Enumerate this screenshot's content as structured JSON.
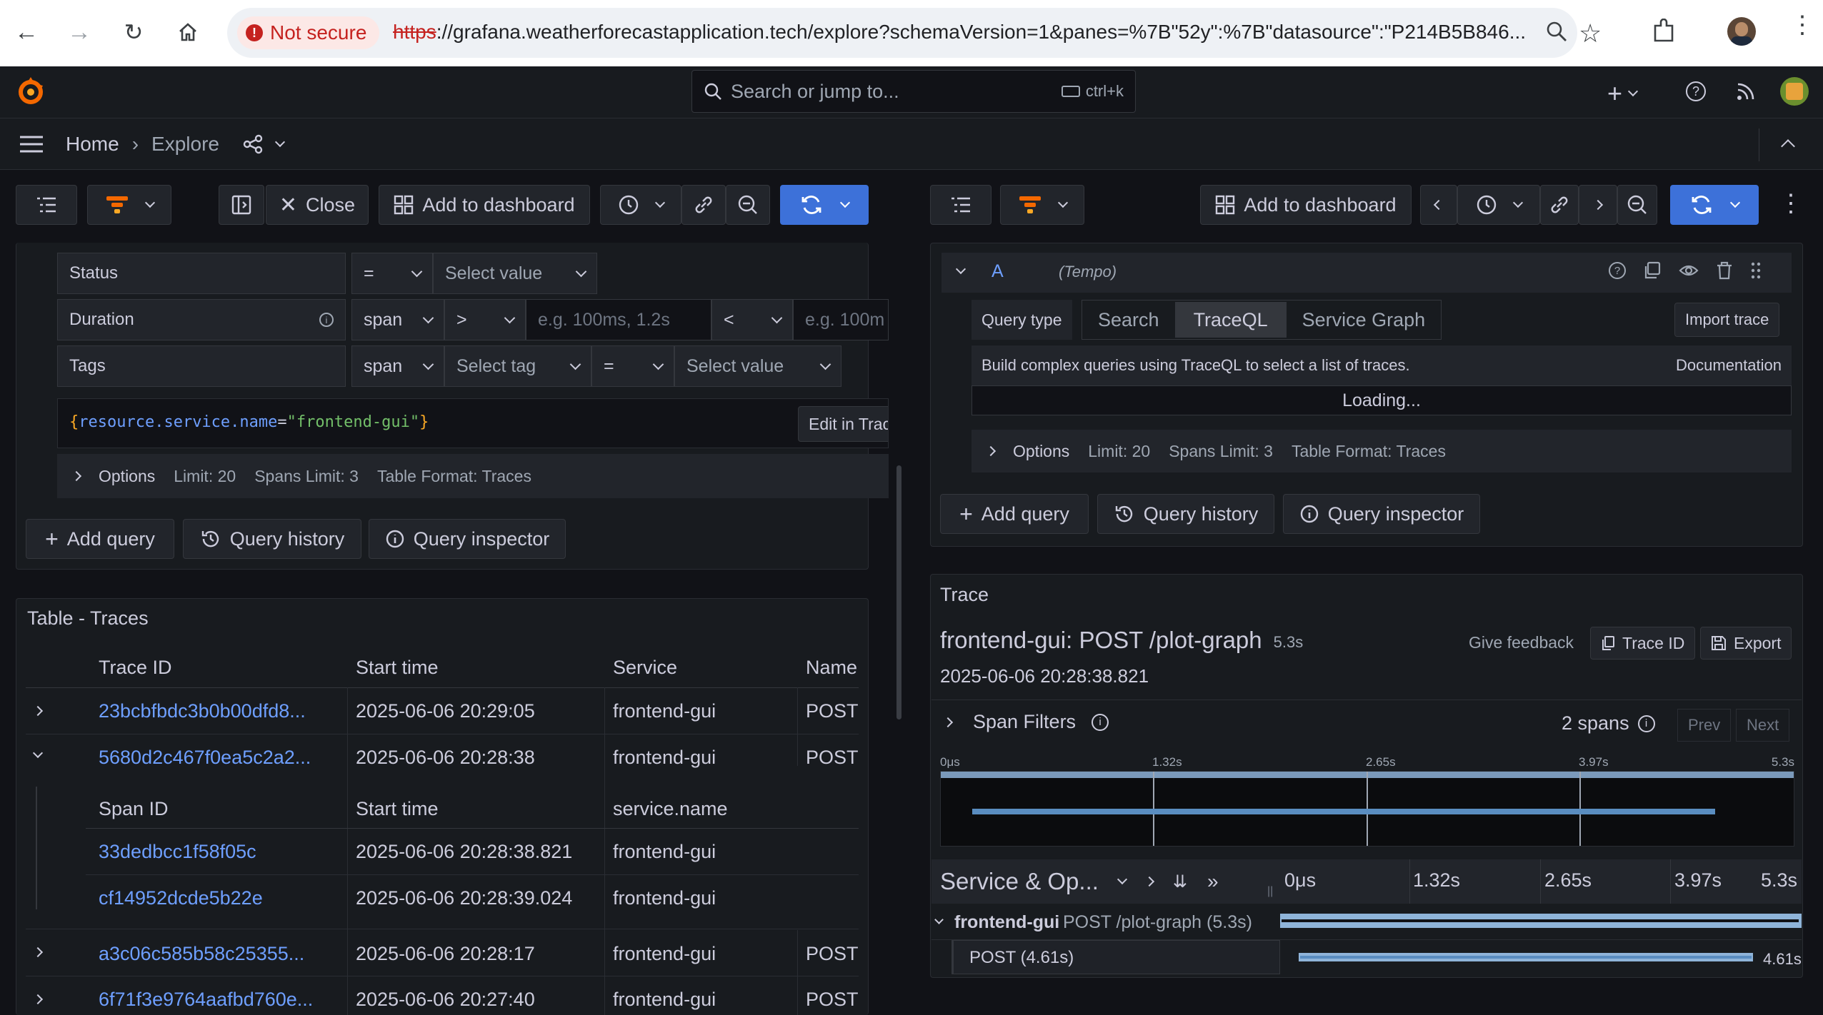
{
  "browser": {
    "not_secure": "Not secure",
    "url_scheme": "https",
    "url_rest": "://grafana.weatherforecastapplication.tech/explore?schemaVersion=1&panes=%7B\"52y\":%7B\"datasource\":\"P214B5B846..."
  },
  "topbar": {
    "search_placeholder": "Search or jump to...",
    "shortcut": "ctrl+k"
  },
  "breadcrumb": {
    "home": "Home",
    "explore": "Explore"
  },
  "left_toolbar": {
    "close": "Close",
    "add_to_dashboard": "Add to dashboard"
  },
  "right_toolbar": {
    "add_to_dashboard": "Add to dashboard"
  },
  "left_query": {
    "status_label": "Status",
    "status_op": "=",
    "status_value": "Select value",
    "duration_label": "Duration",
    "duration_scope": "span",
    "duration_op1": ">",
    "duration_ph1": "e.g. 100ms, 1.2s",
    "duration_op2": "<",
    "duration_ph2": "e.g. 100m",
    "tags_label": "Tags",
    "tags_scope": "span",
    "tags_tag": "Select tag",
    "tags_op": "=",
    "tags_value": "Select value",
    "query_brace_open": "{",
    "query_key": "resource.service.name",
    "query_eq": "=",
    "query_val": "\"frontend-gui\"",
    "query_brace_close": "}",
    "edit_btn": "Edit in Trac",
    "options": "Options",
    "limit": "Limit: 20",
    "spans_limit": "Spans Limit: 3",
    "table_format": "Table Format: Traces"
  },
  "left_actions": {
    "add_query": "Add query",
    "query_history": "Query history",
    "query_inspector": "Query inspector"
  },
  "table": {
    "title": "Table - Traces",
    "headers": [
      "Trace ID",
      "Start time",
      "Service",
      "Name"
    ],
    "rows": [
      {
        "id": "23bcbfbdc3b0b00dfd8...",
        "start": "2025-06-06 20:29:05",
        "service": "frontend-gui",
        "name": "POST"
      },
      {
        "id": "5680d2c467f0ea5c2a2...",
        "start": "2025-06-06 20:28:38",
        "service": "frontend-gui",
        "name": "POST"
      },
      {
        "id": "a3c06c585b58c25355...",
        "start": "2025-06-06 20:28:17",
        "service": "frontend-gui",
        "name": "POST"
      },
      {
        "id": "6f71f3e9764aafbd760e...",
        "start": "2025-06-06 20:27:40",
        "service": "frontend-gui",
        "name": "POST"
      }
    ],
    "sub_headers": [
      "Span ID",
      "Start time",
      "service.name"
    ],
    "sub_rows": [
      {
        "id": "33dedbcc1f58f05c",
        "start": "2025-06-06 20:28:38.821",
        "service": "frontend-gui"
      },
      {
        "id": "cf14952dcde5b22e",
        "start": "2025-06-06 20:28:39.024",
        "service": "frontend-gui"
      }
    ]
  },
  "right_query": {
    "ref": "A",
    "datasource": "(Tempo)",
    "query_type": "Query type",
    "tabs": [
      "Search",
      "TraceQL",
      "Service Graph"
    ],
    "import": "Import trace",
    "desc": "Build complex queries using TraceQL to select a list of traces.",
    "doc": "Documentation",
    "loading": "Loading...",
    "options": "Options",
    "limit": "Limit: 20",
    "spans_limit": "Spans Limit: 3",
    "table_format": "Table Format: Traces"
  },
  "right_actions": {
    "add_query": "Add query",
    "query_history": "Query history",
    "query_inspector": "Query inspector"
  },
  "trace": {
    "header": "Trace",
    "title": "frontend-gui: POST /plot-graph",
    "duration": "5.3s",
    "timestamp": "2025-06-06 20:28:38.821",
    "give_feedback": "Give feedback",
    "trace_id_btn": "Trace ID",
    "export_btn": "Export",
    "span_filters": "Span Filters",
    "span_count": "2 spans",
    "prev": "Prev",
    "next": "Next",
    "ticks": [
      "0μs",
      "1.32s",
      "2.65s",
      "3.97s",
      "5.3s"
    ],
    "service_col": "Service & Op...",
    "span1_service": "frontend-gui",
    "span1_op": "POST /plot-graph (5.3s)",
    "span2_label": "POST (4.61s)",
    "span2_dur": "4.61s"
  }
}
